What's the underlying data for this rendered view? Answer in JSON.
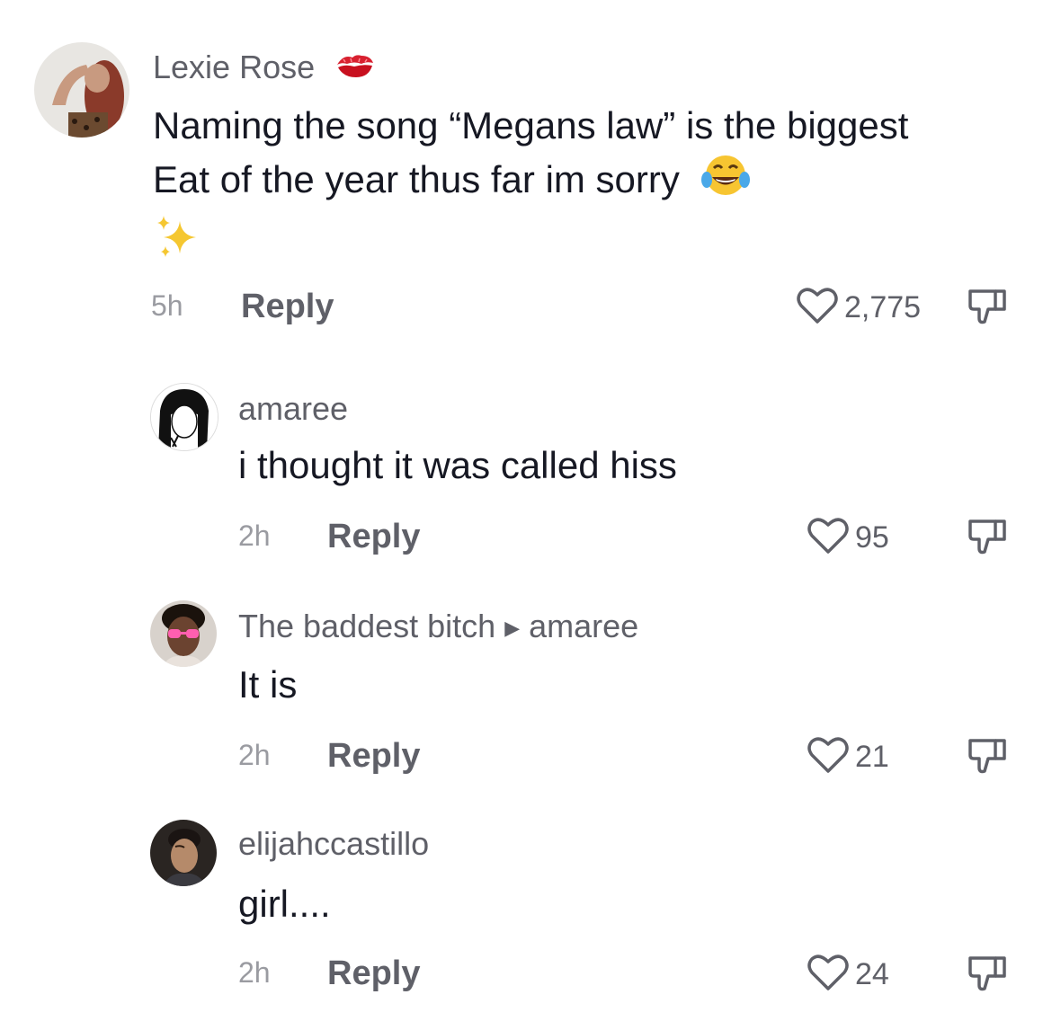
{
  "comments": [
    {
      "username": "Lexie Rose",
      "text": "Naming the song “Megans law” is the biggest Eat of the year thus far im sorry",
      "time": "5h",
      "reply": "Reply",
      "likes": "2,775"
    },
    {
      "username": "amaree",
      "text": "i thought it was called hiss",
      "time": "2h",
      "reply": "Reply",
      "likes": "95"
    },
    {
      "username": "The baddest bitch",
      "reply_to": "amaree",
      "text": "It is",
      "time": "2h",
      "reply": "Reply",
      "likes": "21"
    },
    {
      "username": "elijahccastillo",
      "text": "girl....",
      "time": "2h",
      "reply": "Reply",
      "likes": "24"
    }
  ],
  "icons": {
    "name_emoji": "kiss-mark-icon",
    "text_emoji_1": "laughing-tears-icon",
    "text_emoji_2": "sparkles-icon",
    "like": "heart-outline-icon",
    "dislike": "thumbs-down-outline-icon"
  }
}
